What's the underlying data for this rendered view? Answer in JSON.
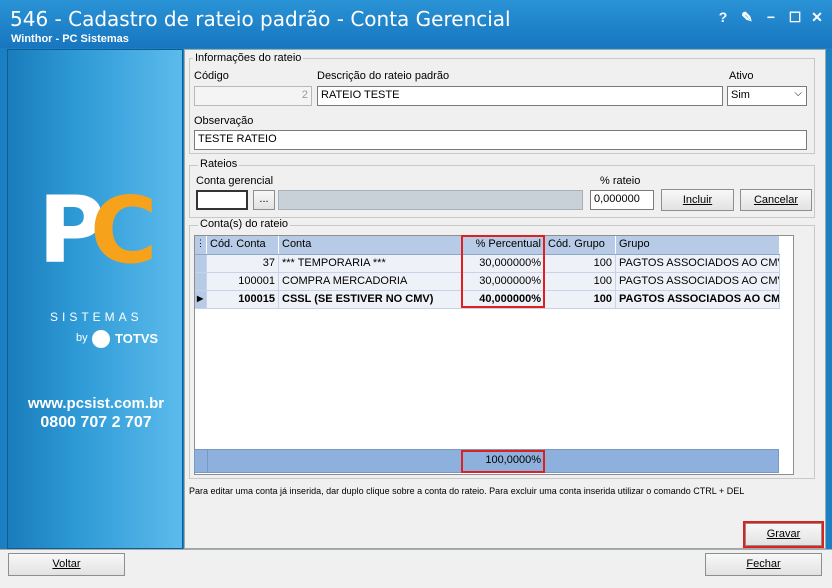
{
  "window": {
    "title": "546 - Cadastro de rateio padrão - Conta Gerencial",
    "subtitle": "Winthor - PC Sistemas",
    "controls": {
      "help": "?",
      "edit": "✎",
      "minimize": "−",
      "maximize": "☐",
      "close": "✕"
    }
  },
  "sidebar": {
    "logo_p": "P",
    "logo_c": "C",
    "brand": "SISTEMAS",
    "by": "by",
    "totvs": "TOTVS",
    "site": "www.pcsist.com.br",
    "phone": "0800 707 2 707"
  },
  "info": {
    "group_title": "Informações do rateio",
    "codigo_label": "Código",
    "codigo_value": "2",
    "descricao_label": "Descrição do rateio padrão",
    "descricao_value": "RATEIO TESTE",
    "ativo_label": "Ativo",
    "ativo_value": "Sim",
    "obs_label": "Observação",
    "obs_value": "TESTE RATEIO"
  },
  "rateios": {
    "group_title": "Rateios",
    "conta_label": "Conta gerencial",
    "conta_value": "",
    "lookup_label": "...",
    "pct_label": "% rateio",
    "pct_value": "0,000000",
    "incluir": "Incluir",
    "cancelar": "Cancelar"
  },
  "contas": {
    "group_title": "Conta(s) do rateio",
    "columns": [
      "Cód. Conta",
      "Conta",
      "% Percentual",
      "Cód. Grupo",
      "Grupo"
    ],
    "rows": [
      {
        "cod": "37",
        "conta": "*** TEMPORARIA ***",
        "pct": "30,000000%",
        "codgrupo": "100",
        "grupo": "PAGTOS ASSOCIADOS AO CMV"
      },
      {
        "cod": "100001",
        "conta": "COMPRA MERCADORIA",
        "pct": "30,000000%",
        "codgrupo": "100",
        "grupo": "PAGTOS ASSOCIADOS AO CMV"
      },
      {
        "cod": "100015",
        "conta": "CSSL (SE ESTIVER NO CMV)",
        "pct": "40,000000%",
        "codgrupo": "100",
        "grupo": "PAGTOS ASSOCIADOS AO CM"
      }
    ],
    "total": "100,0000%"
  },
  "help_text": "Para editar uma conta já inserida, dar duplo clique sobre a conta do rateio. Para excluir uma conta inserida utilizar o comando CTRL + DEL",
  "buttons": {
    "gravar": "Gravar",
    "voltar": "Voltar",
    "fechar": "Fechar"
  },
  "colors": {
    "titlebar": "#1776bf",
    "accent_orange": "#f7a21b",
    "grid_header": "#b7cbe6",
    "highlight": "#e02020"
  }
}
